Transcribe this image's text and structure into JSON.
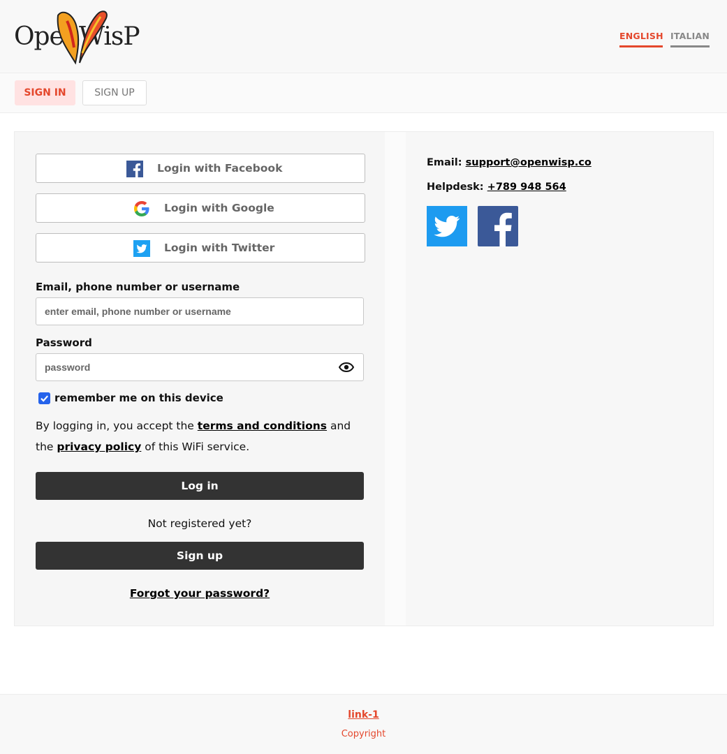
{
  "brand": {
    "logo_text": "OpenWisP"
  },
  "header": {
    "languages": [
      "ENGLISH",
      "ITALIAN"
    ],
    "active_language": "ENGLISH"
  },
  "tabs": {
    "sign_in": "SIGN IN",
    "sign_up": "SIGN UP",
    "active": "SIGN IN"
  },
  "social_login": {
    "facebook": "Login with Facebook",
    "google": "Login with Google",
    "twitter": "Login with Twitter"
  },
  "form": {
    "username_label": "Email, phone number or username",
    "username_placeholder": "enter email, phone number or username",
    "password_label": "Password",
    "password_placeholder": "password",
    "remember_label": "remember me on this device",
    "remember_checked": true,
    "terms_prefix": "By logging in, you accept the",
    "terms_link": "terms and conditions",
    "terms_mid": "and the",
    "privacy_link": "privacy policy",
    "terms_suffix": "of this WiFi service.",
    "login_button": "Log in",
    "not_registered": "Not registered yet?",
    "signup_button": "Sign up",
    "forgot_link": "Forgot your password?"
  },
  "contact": {
    "email_label": "Email:",
    "email_value": "support@openwisp.co",
    "helpdesk_label": "Helpdesk:",
    "helpdesk_value": "+789 948 564",
    "social_icons": [
      "twitter-icon",
      "facebook-icon"
    ]
  },
  "footer": {
    "link": "link-1",
    "copyright": "Copyright"
  },
  "colors": {
    "accent": "#e4472c",
    "dark_button": "#333333",
    "facebook": "#3b5998",
    "twitter": "#1da1f2"
  }
}
